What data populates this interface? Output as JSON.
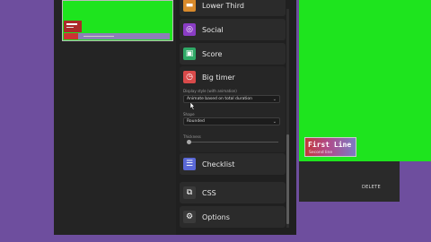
{
  "menu": {
    "items": [
      {
        "label": "Lower Third",
        "icon": "lower-third-icon",
        "color": "#d98a2b"
      },
      {
        "label": "Social",
        "icon": "social-icon",
        "color": "#8a3dc4"
      },
      {
        "label": "Score",
        "icon": "score-icon",
        "color": "#2fa866"
      },
      {
        "label": "Big timer",
        "icon": "timer-icon",
        "color": "#d94a4a"
      },
      {
        "label": "Checklist",
        "icon": "checklist-icon",
        "color": "#5a68d6"
      },
      {
        "label": "CSS",
        "icon": "css-icon",
        "color": "#3a3a3a"
      },
      {
        "label": "Options",
        "icon": "options-icon",
        "color": "#3a3a3a"
      }
    ]
  },
  "big_timer": {
    "style_label": "Display style (with animation)",
    "style_value": "Animate based on total duration",
    "shape_label": "Shape",
    "shape_value": "Rounded",
    "thickness_label": "Thickness",
    "thickness_fraction": 0.0
  },
  "preview": {
    "first_line": "First Line",
    "second_line": "Second line"
  },
  "delete_label": "DELETE"
}
